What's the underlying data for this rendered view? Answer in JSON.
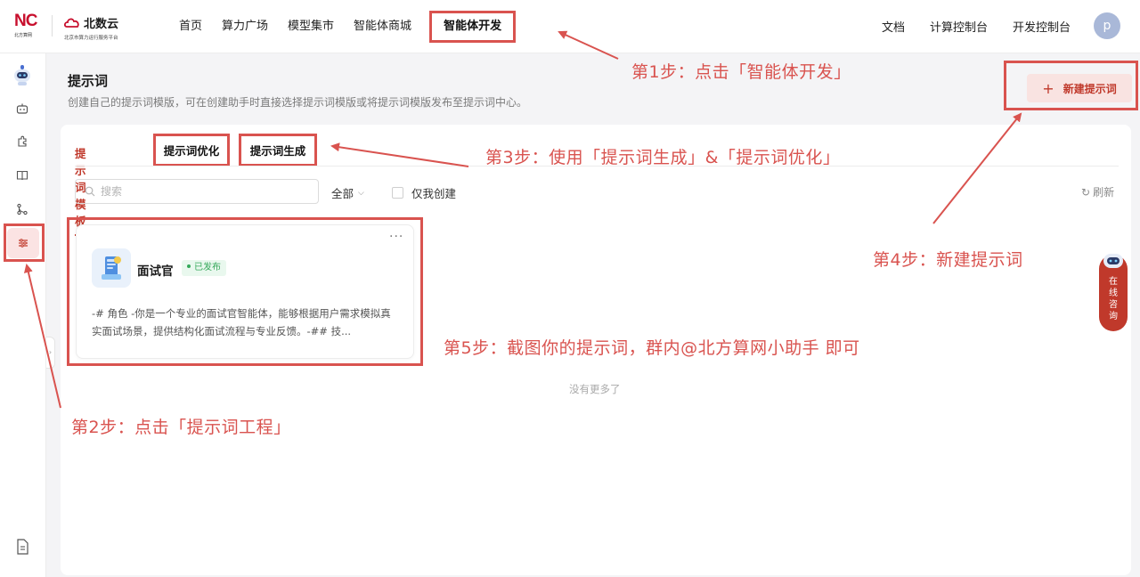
{
  "header": {
    "logo_nc_mark": "NC",
    "logo_nc_sub": "北方算网",
    "logo_bs_name": "北数云",
    "logo_bs_sub": "北京市算力运行服务平台",
    "nav": [
      "首页",
      "算力广场",
      "模型集市",
      "智能体商城",
      "智能体开发"
    ],
    "right_links": [
      "文档",
      "计算控制台",
      "开发控制台"
    ],
    "avatar_letter": "p"
  },
  "sidebar": {
    "icons": [
      "robot-logo-icon",
      "bot-icon",
      "plugin-icon",
      "book-icon",
      "workflow-icon",
      "prompt-engineering-icon",
      "document-icon"
    ]
  },
  "page": {
    "title": "提示词",
    "description": "创建自己的提示词模版，可在创建助手时直接选择提示词模版或将提示词模版发布至提示词中心。",
    "new_button": "新建提示词",
    "tabs": [
      "提示词模板",
      "提示词优化",
      "提示词生成"
    ],
    "search_placeholder": "搜索",
    "filter_label": "全部",
    "only_mine_label": "仅我创建",
    "refresh_label": "刷新",
    "no_more": "没有更多了"
  },
  "cards": [
    {
      "name": "面试官",
      "status": "已发布",
      "description": "-# 角色 -你是一个专业的面试官智能体，能够根据用户需求模拟真实面试场景，提供结构化面试流程与专业反馈。-## 技..."
    }
  ],
  "consult": {
    "label": "在线咨询"
  },
  "annotations": {
    "step1": "第1步：点击「智能体开发」",
    "step2": "第2步：点击「提示词工程」",
    "step3": "第3步：使用「提示词生成」&「提示词优化」",
    "step4": "第4步：新建提示词",
    "step5": "第5步：截图你的提示词，群内@北方算网小助手 即可"
  },
  "colors": {
    "accent": "#c0392b",
    "annotation": "#d9534f",
    "published": "#35a85a"
  }
}
